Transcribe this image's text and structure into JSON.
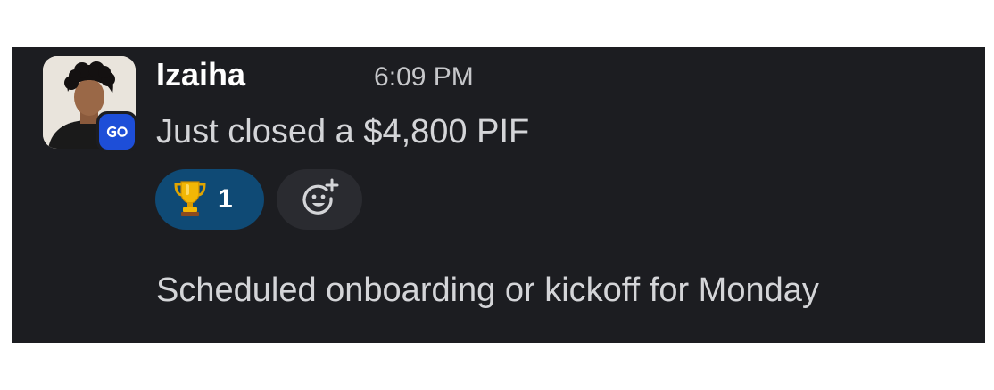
{
  "message": {
    "username": "Izaiha",
    "timestamp": "6:09 PM",
    "text": "Just closed a $4,800 PIF",
    "app_badge_icon": "go-app-icon",
    "reactions": [
      {
        "emoji_icon": "trophy-icon",
        "count": "1"
      }
    ],
    "add_reaction_icon": "add-reaction-icon"
  },
  "followup": {
    "text": "Scheduled onboarding or kickoff for Monday"
  },
  "colors": {
    "background": "#1c1d21",
    "reaction_active": "#0f4a75",
    "reaction_add": "#2a2b30",
    "badge": "#1d4ed8"
  }
}
